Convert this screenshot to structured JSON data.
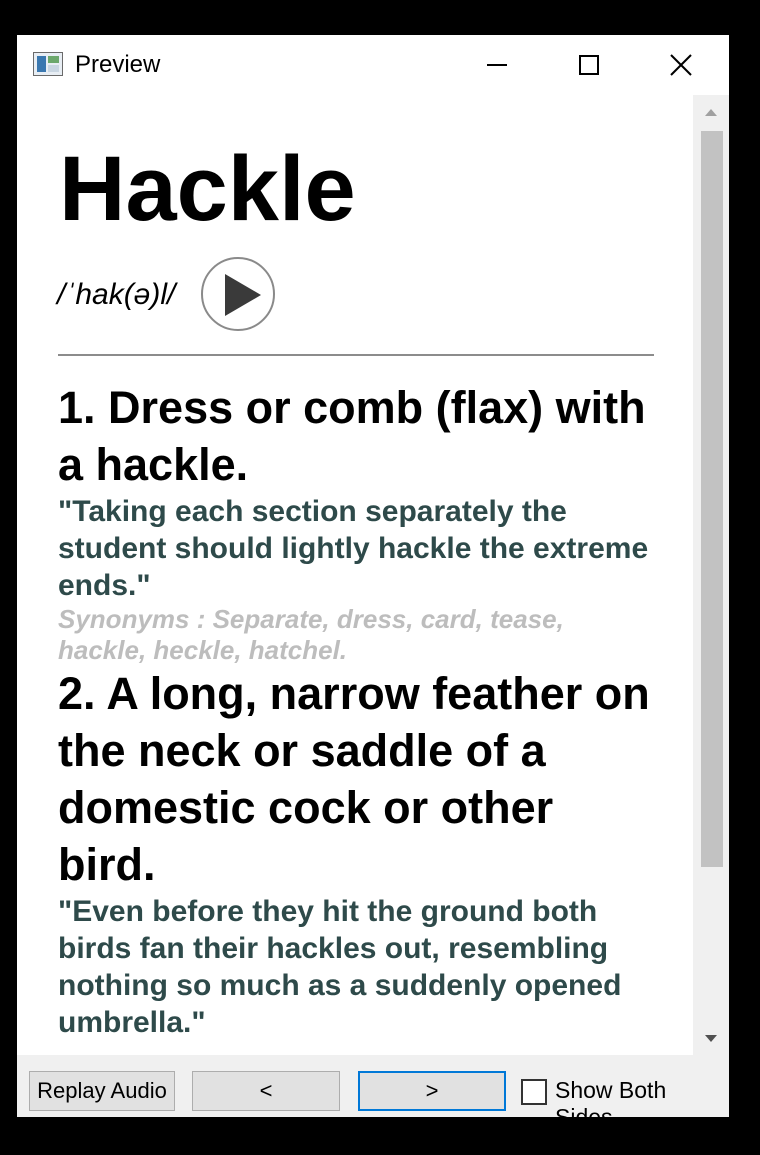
{
  "window": {
    "title": "Preview"
  },
  "entry": {
    "word": "Hackle",
    "pronunciation": "/ˈhak(ə)l/",
    "definitions": [
      {
        "title": "1. Dress or comb (flax) with a hackle.",
        "quote": "\"Taking each section separately the student should lightly hackle the extreme ends.\"",
        "synonyms": "Synonyms : Separate, dress, card, tease, hackle, heckle, hatchel."
      },
      {
        "title": "2. A long, narrow feather on the neck or saddle of a domestic cock or other bird.",
        "quote": "\"Even before they hit the ground both birds fan their hackles out, resembling nothing so much as a suddenly opened umbrella.\""
      }
    ]
  },
  "footer": {
    "replay_label": "Replay Audio",
    "prev_label": "<",
    "next_label": ">",
    "show_both_sides_label": "Show Both Sides",
    "show_both_sides_checked": false
  },
  "colors": {
    "quote": "#2e4a4a",
    "synonyms": "#bdbdbd",
    "focus_border": "#0078d7"
  },
  "icons": {
    "app": "preview-app-icon",
    "minimize": "minimize-icon",
    "maximize": "maximize-icon",
    "close": "close-icon",
    "play": "play-icon",
    "scroll_up": "scroll-up-arrow-icon",
    "scroll_down": "scroll-down-arrow-icon"
  }
}
